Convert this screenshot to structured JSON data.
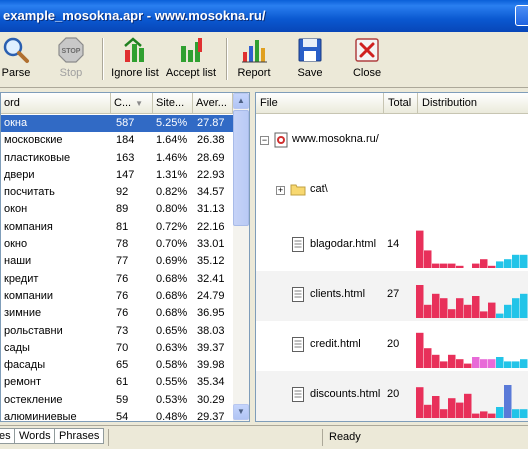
{
  "window": {
    "title": "example_mosokna.apr - www.mosokna.ru/"
  },
  "toolbar": {
    "parse": "Parse",
    "stop": "Stop",
    "ignore_list": "Ignore list",
    "accept_list": "Accept list",
    "report": "Report",
    "save": "Save",
    "close": "Close",
    "stop_badge": "STOP"
  },
  "words_table": {
    "headers": [
      "ord",
      "C...",
      "Site...",
      "Aver..."
    ],
    "rows": [
      {
        "word": "окна",
        "count": "587",
        "site": "5.25%",
        "avg": "27.87",
        "selected": true
      },
      {
        "word": "московские",
        "count": "184",
        "site": "1.64%",
        "avg": "26.38"
      },
      {
        "word": "пластиковые",
        "count": "163",
        "site": "1.46%",
        "avg": "28.69"
      },
      {
        "word": "двери",
        "count": "147",
        "site": "1.31%",
        "avg": "22.93"
      },
      {
        "word": "посчитать",
        "count": "92",
        "site": "0.82%",
        "avg": "34.57"
      },
      {
        "word": "окон",
        "count": "89",
        "site": "0.80%",
        "avg": "31.13"
      },
      {
        "word": "компания",
        "count": "81",
        "site": "0.72%",
        "avg": "22.16"
      },
      {
        "word": "окно",
        "count": "78",
        "site": "0.70%",
        "avg": "33.01"
      },
      {
        "word": "наши",
        "count": "77",
        "site": "0.69%",
        "avg": "35.12"
      },
      {
        "word": "кредит",
        "count": "76",
        "site": "0.68%",
        "avg": "32.41"
      },
      {
        "word": "компании",
        "count": "76",
        "site": "0.68%",
        "avg": "24.79"
      },
      {
        "word": "зимние",
        "count": "76",
        "site": "0.68%",
        "avg": "36.95"
      },
      {
        "word": "рольставни",
        "count": "73",
        "site": "0.65%",
        "avg": "38.03"
      },
      {
        "word": "сады",
        "count": "70",
        "site": "0.63%",
        "avg": "39.37"
      },
      {
        "word": "фасады",
        "count": "65",
        "site": "0.58%",
        "avg": "39.98"
      },
      {
        "word": "ремонт",
        "count": "61",
        "site": "0.55%",
        "avg": "35.34"
      },
      {
        "word": "остекление",
        "count": "59",
        "site": "0.53%",
        "avg": "30.29"
      },
      {
        "word": "алюминиевые",
        "count": "54",
        "site": "0.48%",
        "avg": "29.37"
      }
    ]
  },
  "files_tree": {
    "headers": [
      "File",
      "Total",
      "Distribution"
    ],
    "root": "www.mosokna.ru/",
    "folder": "cat\\",
    "files": [
      {
        "name": "blagodar.html",
        "total": "14",
        "bars": [
          0.85,
          0.4,
          0.1,
          0.1,
          0.1,
          0.05,
          0,
          0.1,
          0.2,
          0.05,
          0.15,
          0.2,
          0.3,
          0.3,
          0.35
        ],
        "colors": [
          "#e8305a",
          "#e8305a",
          "#e8305a",
          "#e8305a",
          "#e8305a",
          "#e8305a",
          "#e8305a",
          "#e8305a",
          "#e8305a",
          "#e8305a",
          "#22c4e8",
          "#22c4e8",
          "#22c4e8",
          "#22c4e8",
          "#22c4e8"
        ]
      },
      {
        "name": "clients.html",
        "total": "27",
        "bars": [
          0.75,
          0.3,
          0.55,
          0.45,
          0.2,
          0.45,
          0.3,
          0.5,
          0.15,
          0.35,
          0.1,
          0.3,
          0.45,
          0.55,
          0.45
        ],
        "colors": [
          "#e8305a",
          "#e8305a",
          "#e8305a",
          "#e8305a",
          "#e8305a",
          "#e8305a",
          "#e8305a",
          "#e8305a",
          "#e8305a",
          "#e8305a",
          "#22c4e8",
          "#22c4e8",
          "#22c4e8",
          "#22c4e8",
          "#22c4e8"
        ]
      },
      {
        "name": "credit.html",
        "total": "20",
        "bars": [
          0.8,
          0.45,
          0.3,
          0.15,
          0.3,
          0.2,
          0.1,
          0.25,
          0.2,
          0.2,
          0.25,
          0.15,
          0.15,
          0.2,
          0.2
        ],
        "colors": [
          "#e8305a",
          "#e8305a",
          "#e8305a",
          "#e8305a",
          "#e8305a",
          "#e8305a",
          "#e8305a",
          "#e86ad8",
          "#e86ad8",
          "#e86ad8",
          "#22c4e8",
          "#22c4e8",
          "#22c4e8",
          "#22c4e8",
          "#22c4e8"
        ]
      },
      {
        "name": "discounts.html",
        "total": "20",
        "bars": [
          0.7,
          0.3,
          0.5,
          0.2,
          0.45,
          0.35,
          0.55,
          0.1,
          0.15,
          0.1,
          0.25,
          0.75,
          0.2,
          0.2,
          0.65
        ],
        "colors": [
          "#e8305a",
          "#e8305a",
          "#e8305a",
          "#e8305a",
          "#e8305a",
          "#e8305a",
          "#e8305a",
          "#e8305a",
          "#e8305a",
          "#e8305a",
          "#22c4e8",
          "#5a7ad8",
          "#22c4e8",
          "#22c4e8",
          "#22c4e8"
        ]
      }
    ]
  },
  "bottom_tabs": [
    "es",
    "Words",
    "Phrases"
  ],
  "status": {
    "text": "Ready"
  }
}
